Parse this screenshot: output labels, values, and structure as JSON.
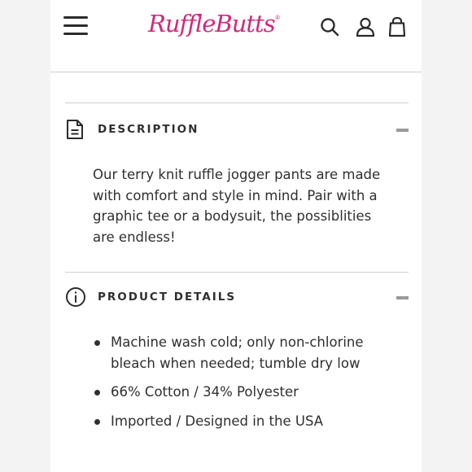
{
  "brand": {
    "logo_text": "RuffleButts",
    "trademark": "®",
    "color": "#d2287a"
  },
  "header": {
    "menu_icon": "hamburger-menu-icon",
    "search_icon": "search-icon",
    "account_icon": "account-icon",
    "bag_icon": "shopping-bag-icon"
  },
  "description": {
    "title": "DESCRIPTION",
    "icon": "document-icon",
    "state_icon": "collapse-minus-icon",
    "text": "Our terry knit ruffle jogger pants are made with comfort and style in mind. Pair with a graphic tee or a bodysuit, the possiblities are endless!"
  },
  "product_details": {
    "title": "PRODUCT DETAILS",
    "icon": "info-icon",
    "state_icon": "collapse-minus-icon",
    "items": [
      "Machine wash cold; only non-chlorine bleach when needed; tumble dry low",
      "66% Cotton / 34% Polyester",
      "Imported / Designed in the USA"
    ]
  }
}
